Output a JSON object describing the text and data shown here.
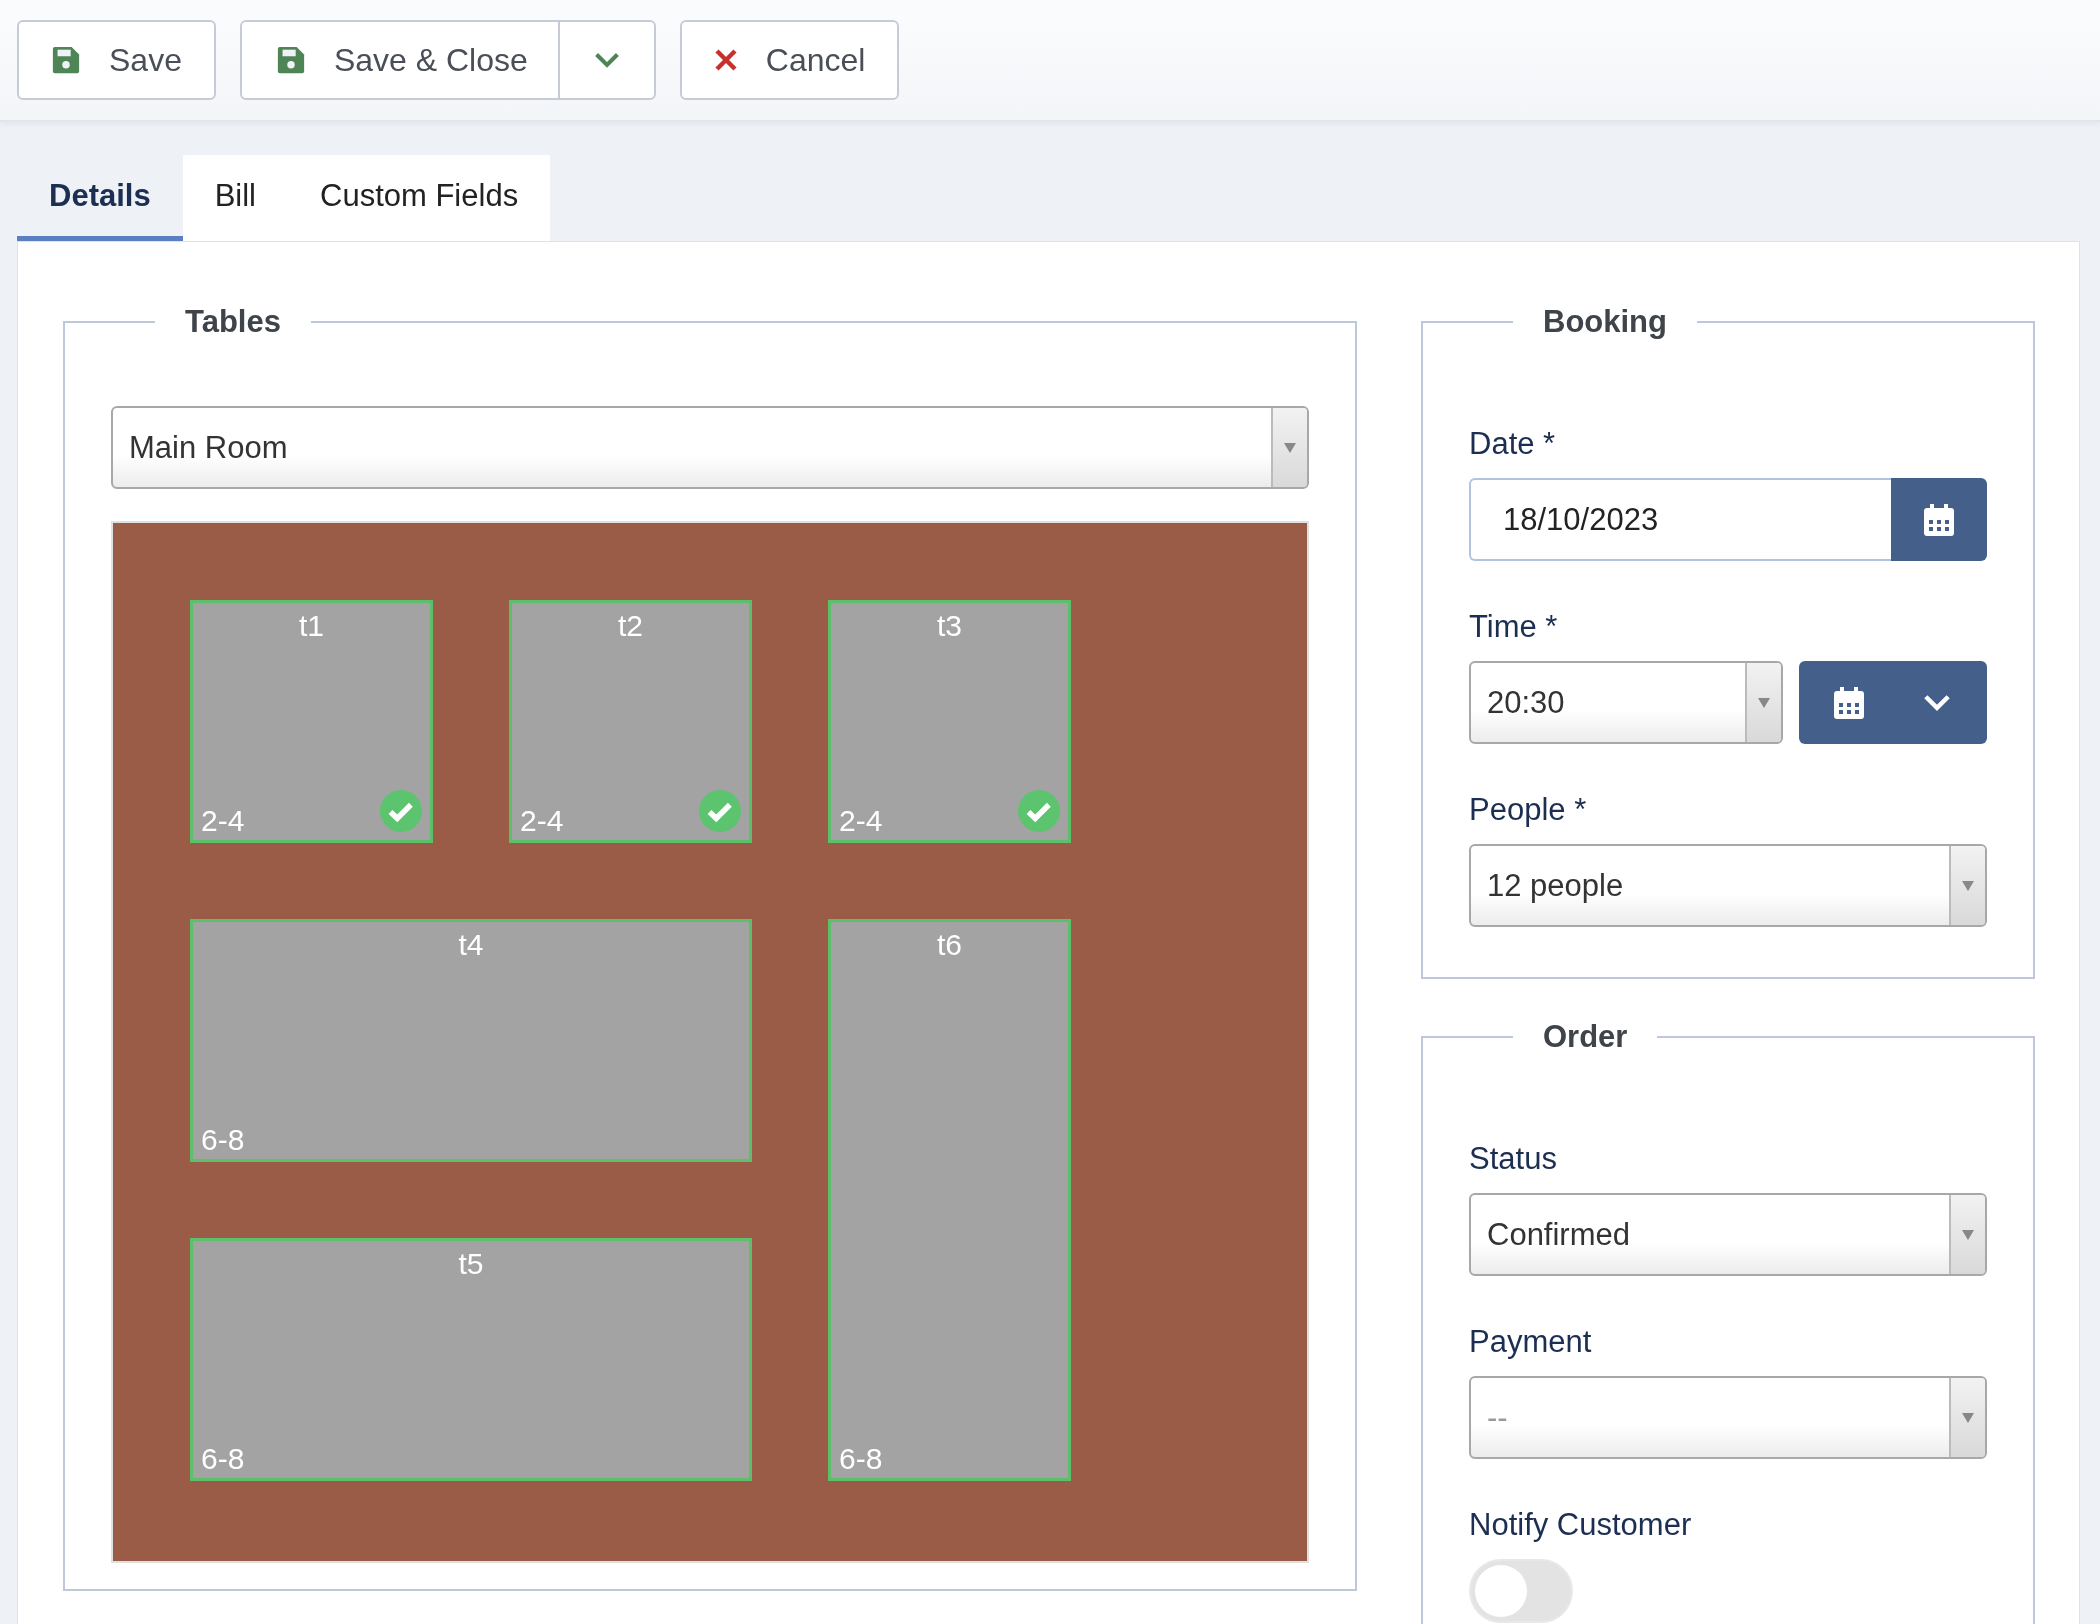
{
  "toolbar": {
    "buttons": [
      {
        "kind": "save",
        "label": "Save"
      },
      {
        "kind": "split",
        "label": "Save & Close"
      },
      {
        "kind": "cancel",
        "label": "Cancel"
      }
    ]
  },
  "tabs": [
    {
      "label": "Details",
      "selected": true
    },
    {
      "label": "Bill",
      "selected": false
    },
    {
      "label": "Custom Fields",
      "selected": false
    }
  ],
  "tables_panel": {
    "legend": "Tables",
    "room": "Main Room",
    "tables": [
      {
        "name": "t1",
        "capacity": "2-4",
        "available": true
      },
      {
        "name": "t2",
        "capacity": "2-4",
        "available": true
      },
      {
        "name": "t3",
        "capacity": "2-4",
        "available": true
      },
      {
        "name": "t4",
        "capacity": "6-8",
        "available": false
      },
      {
        "name": "t5",
        "capacity": "6-8",
        "available": false
      },
      {
        "name": "t6",
        "capacity": "6-8",
        "available": false
      }
    ]
  },
  "booking": {
    "legend": "Booking",
    "date": {
      "label": "Date *",
      "value": "18/10/2023"
    },
    "time": {
      "label": "Time *",
      "value": "20:30"
    },
    "people": {
      "label": "People *",
      "value": "12 people"
    }
  },
  "order": {
    "legend": "Order",
    "status": {
      "label": "Status",
      "value": "Confirmed"
    },
    "payment": {
      "label": "Payment",
      "placeholder": "--"
    },
    "notify": {
      "label": "Notify Customer",
      "on": false
    }
  }
}
